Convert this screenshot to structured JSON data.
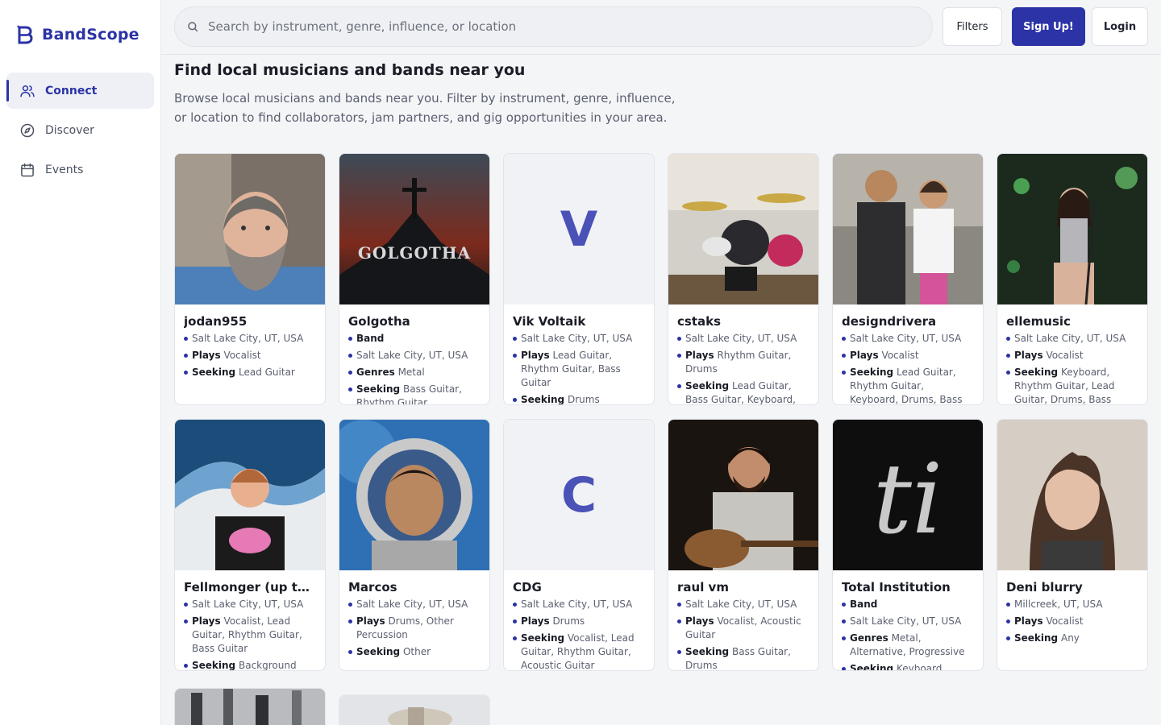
{
  "app": {
    "name": "BandScope"
  },
  "nav": [
    {
      "label": "Connect",
      "icon": "users-icon",
      "active": true
    },
    {
      "label": "Discover",
      "icon": "compass-icon",
      "active": false
    },
    {
      "label": "Events",
      "icon": "calendar-icon",
      "active": false
    }
  ],
  "search": {
    "placeholder": "Search by instrument, genre, influence, or location"
  },
  "buttons": {
    "filters": "Filters",
    "signup": "Sign Up!",
    "login": "Login"
  },
  "page": {
    "title": "Find local musicians and bands near you",
    "description": "Browse local musicians and bands near you. Filter by instrument, genre, influence, or location to find collaborators, jam partners, and gig opportunities in your area."
  },
  "colors": {
    "accent": "#2b33a6"
  },
  "musicians": [
    {
      "name": "jodan955",
      "image": "photo-bearded-man",
      "lines": [
        {
          "label": "",
          "value": "Salt Lake City, UT, USA"
        },
        {
          "label": "Plays",
          "value": "Vocalist"
        },
        {
          "label": "Seeking",
          "value": "Lead Guitar"
        }
      ]
    },
    {
      "name": "Golgotha",
      "image": "photo-golgotha-logo",
      "lines": [
        {
          "label": "Band",
          "value": ""
        },
        {
          "label": "",
          "value": "Salt Lake City, UT, USA"
        },
        {
          "label": "Genres",
          "value": "Metal"
        },
        {
          "label": "Seeking",
          "value": "Bass Guitar, Rhythm Guitar"
        }
      ]
    },
    {
      "name": "Vik Voltaik",
      "initial": "V",
      "lines": [
        {
          "label": "",
          "value": "Salt Lake City, UT, USA"
        },
        {
          "label": "Plays",
          "value": "Lead Guitar, Rhythm Guitar, Bass Guitar"
        },
        {
          "label": "Seeking",
          "value": "Drums"
        }
      ]
    },
    {
      "name": "cstaks",
      "image": "photo-drum-kit",
      "lines": [
        {
          "label": "",
          "value": "Salt Lake City, UT, USA"
        },
        {
          "label": "Plays",
          "value": "Rhythm Guitar, Drums"
        },
        {
          "label": "Seeking",
          "value": "Lead Guitar, Bass Guitar, Keyboard, Piano"
        }
      ]
    },
    {
      "name": "designdrivera",
      "image": "photo-two-people",
      "lines": [
        {
          "label": "",
          "value": "Salt Lake City, UT, USA"
        },
        {
          "label": "Plays",
          "value": "Vocalist"
        },
        {
          "label": "Seeking",
          "value": "Lead Guitar, Rhythm Guitar, Keyboard, Drums, Bass"
        }
      ]
    },
    {
      "name": "ellemusic",
      "image": "photo-singer-stage",
      "lines": [
        {
          "label": "",
          "value": "Salt Lake City, UT, USA"
        },
        {
          "label": "Plays",
          "value": "Vocalist"
        },
        {
          "label": "Seeking",
          "value": "Keyboard, Rhythm Guitar, Lead Guitar, Drums, Bass"
        }
      ]
    },
    {
      "name": "Fellmonger (up to c...",
      "image": "photo-man-wave-mural",
      "lines": [
        {
          "label": "",
          "value": "Salt Lake City, UT, USA"
        },
        {
          "label": "Plays",
          "value": "Vocalist, Lead Guitar, Rhythm Guitar, Bass Guitar"
        },
        {
          "label": "Seeking",
          "value": "Background"
        }
      ]
    },
    {
      "name": "Marcos",
      "image": "photo-astronaut-portrait",
      "lines": [
        {
          "label": "",
          "value": "Salt Lake City, UT, USA"
        },
        {
          "label": "Plays",
          "value": "Drums, Other Percussion"
        },
        {
          "label": "Seeking",
          "value": "Other"
        }
      ]
    },
    {
      "name": "CDG",
      "initial": "C",
      "lines": [
        {
          "label": "",
          "value": "Salt Lake City, UT, USA"
        },
        {
          "label": "Plays",
          "value": "Drums"
        },
        {
          "label": "Seeking",
          "value": "Vocalist, Lead Guitar, Rhythm Guitar, Acoustic Guitar"
        }
      ]
    },
    {
      "name": "raul vm",
      "image": "photo-guitarist-singing",
      "lines": [
        {
          "label": "",
          "value": "Salt Lake City, UT, USA"
        },
        {
          "label": "Plays",
          "value": "Vocalist, Acoustic Guitar"
        },
        {
          "label": "Seeking",
          "value": "Bass Guitar, Drums"
        }
      ]
    },
    {
      "name": "Total Institution",
      "image": "photo-ti-logo",
      "lines": [
        {
          "label": "Band",
          "value": ""
        },
        {
          "label": "",
          "value": "Salt Lake City, UT, USA"
        },
        {
          "label": "Genres",
          "value": "Metal, Alternative, Progressive"
        },
        {
          "label": "Seeking",
          "value": "Keyboard, Piano"
        }
      ]
    },
    {
      "name": "Deni blurry",
      "image": "photo-woman-portrait",
      "lines": [
        {
          "label": "",
          "value": "Millcreek, UT, USA"
        },
        {
          "label": "Plays",
          "value": "Vocalist"
        },
        {
          "label": "Seeking",
          "value": "Any"
        }
      ]
    }
  ]
}
